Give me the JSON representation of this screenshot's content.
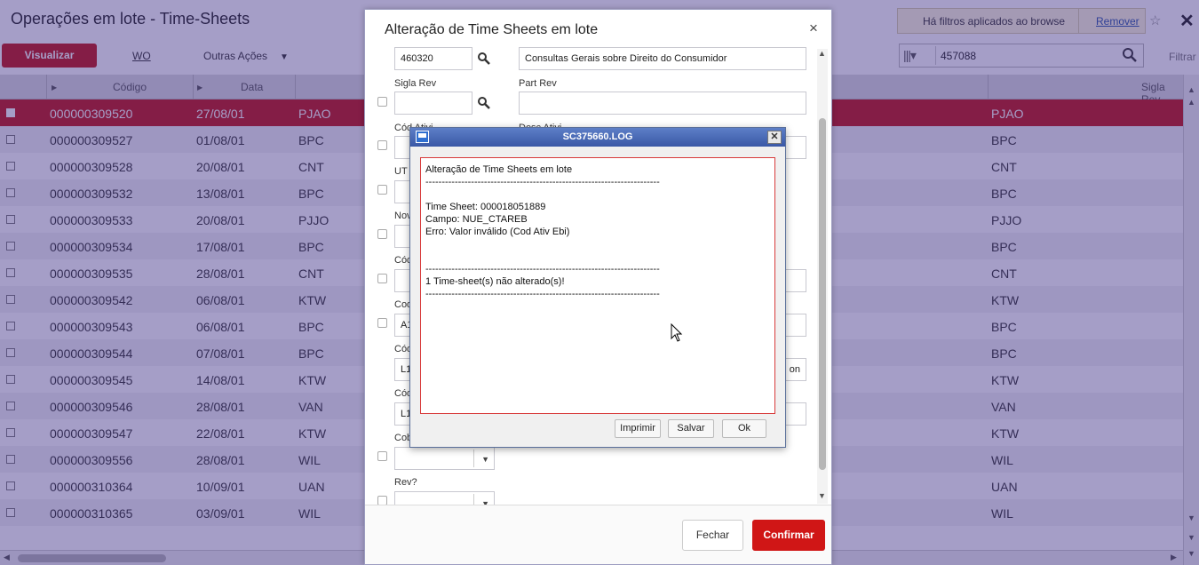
{
  "page": {
    "title": "Operações em lote - Time-Sheets",
    "filter_notice": "Há filtros aplicados ao browse",
    "filter_remove": "Remover",
    "toolbar": {
      "visualizar": "Visualizar",
      "wo": "WO",
      "outras_acoes": "Outras Ações"
    },
    "search_value": "457088",
    "filtrar": "Filtrar",
    "grid": {
      "headers": [
        "Código",
        "Data",
        "Sigla Rev"
      ],
      "rows": [
        {
          "codigo": "000000309520",
          "data": "27/08/01",
          "sigla": "PJAO",
          "sigla_rev": "PJAO"
        },
        {
          "codigo": "000000309527",
          "data": "01/08/01",
          "sigla": "BPC",
          "sigla_rev": "BPC"
        },
        {
          "codigo": "000000309528",
          "data": "20/08/01",
          "sigla": "CNT",
          "sigla_rev": "CNT"
        },
        {
          "codigo": "000000309532",
          "data": "13/08/01",
          "sigla": "BPC",
          "sigla_rev": "BPC"
        },
        {
          "codigo": "000000309533",
          "data": "20/08/01",
          "sigla": "PJJO",
          "sigla_rev": "PJJO"
        },
        {
          "codigo": "000000309534",
          "data": "17/08/01",
          "sigla": "BPC",
          "sigla_rev": "BPC"
        },
        {
          "codigo": "000000309535",
          "data": "28/08/01",
          "sigla": "CNT",
          "sigla_rev": "CNT"
        },
        {
          "codigo": "000000309542",
          "data": "06/08/01",
          "sigla": "KTW",
          "sigla_rev": "KTW"
        },
        {
          "codigo": "000000309543",
          "data": "06/08/01",
          "sigla": "BPC",
          "sigla_rev": "BPC"
        },
        {
          "codigo": "000000309544",
          "data": "07/08/01",
          "sigla": "BPC",
          "sigla_rev": "BPC"
        },
        {
          "codigo": "000000309545",
          "data": "14/08/01",
          "sigla": "KTW",
          "sigla_rev": "KTW"
        },
        {
          "codigo": "000000309546",
          "data": "28/08/01",
          "sigla": "VAN",
          "sigla_rev": "VAN"
        },
        {
          "codigo": "000000309547",
          "data": "22/08/01",
          "sigla": "KTW",
          "sigla_rev": "KTW"
        },
        {
          "codigo": "000000309556",
          "data": "28/08/01",
          "sigla": "WIL",
          "sigla_rev": "WIL"
        },
        {
          "codigo": "000000310364",
          "data": "10/09/01",
          "sigla": "UAN",
          "sigla_rev": "UAN"
        },
        {
          "codigo": "000000310365",
          "data": "03/09/01",
          "sigla": "WIL",
          "sigla_rev": "WIL"
        }
      ]
    }
  },
  "modal": {
    "title": "Alteração de Time Sheets em lote",
    "close": "×",
    "fields": {
      "codigo_value": "460320",
      "descricao_value": "Consultas Gerais sobre Direito do Consumidor",
      "sigla_rev_label": "Sigla Rev",
      "part_rev_label": "Part Rev",
      "cod_ativ_label": "Cód Ativi",
      "desc_ativ_label": "Desc Ativi",
      "ut_label": "UT I",
      "novo_label": "Nov",
      "cod_label_1": "Cód",
      "cod_label_2": "Cod",
      "cod_value_2": "A1",
      "cod_label_3": "Cód",
      "cod_value_3": "L1",
      "cod_value_3_right": "on",
      "cod_label_4": "Cód",
      "cod_value_4": "L1",
      "cob_label": "Cob",
      "rev_label": "Rev?"
    },
    "buttons": {
      "fechar": "Fechar",
      "confirmar": "Confirmar"
    }
  },
  "log": {
    "title": "SC375660.LOG",
    "lines": [
      "Alteração de Time Sheets em lote",
      "------------------------------------------------------------------------",
      "",
      "Time Sheet: 000018051889",
      "Campo: NUE_CTAREB",
      "Erro: Valor inválido (Cod Ativ Ebi)",
      "",
      "",
      "------------------------------------------------------------------------",
      "1 Time-sheet(s) não alterado(s)!",
      "------------------------------------------------------------------------"
    ],
    "buttons": {
      "imprimir": "Imprimir",
      "salvar": "Salvar",
      "ok": "Ok"
    }
  },
  "colors": {
    "accent_red": "#c41414",
    "overlay": "#372882",
    "log_titlebar": "#4a68b5"
  }
}
